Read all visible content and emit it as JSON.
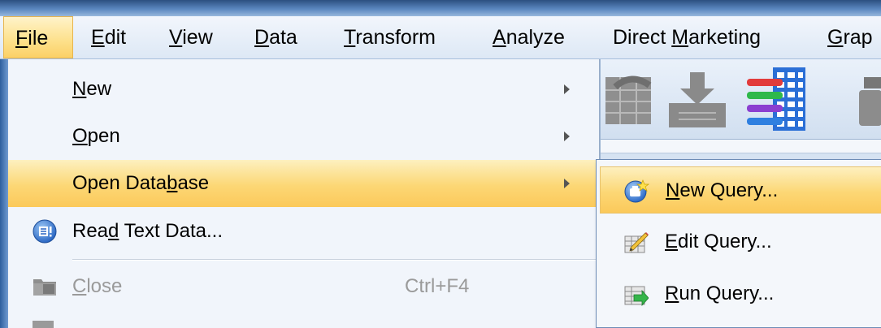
{
  "menubar": {
    "items": [
      {
        "pre": "",
        "mn": "F",
        "post": "ile"
      },
      {
        "pre": "",
        "mn": "E",
        "post": "dit"
      },
      {
        "pre": "",
        "mn": "V",
        "post": "iew"
      },
      {
        "pre": "",
        "mn": "D",
        "post": "ata"
      },
      {
        "pre": "",
        "mn": "T",
        "post": "ransform"
      },
      {
        "pre": "",
        "mn": "A",
        "post": "nalyze"
      },
      {
        "pre": "Direct ",
        "mn": "M",
        "post": "arketing"
      },
      {
        "pre": "",
        "mn": "G",
        "post": "rap"
      }
    ]
  },
  "file_menu": {
    "items": [
      {
        "pre": "",
        "mn": "N",
        "post": "ew",
        "submenu": true
      },
      {
        "pre": "",
        "mn": "O",
        "post": "pen",
        "submenu": true
      },
      {
        "pre": "Open Data",
        "mn": "b",
        "post": "ase",
        "submenu": true
      },
      {
        "pre": "Rea",
        "mn": "d",
        "post": " Text Data...",
        "icon": "read-text-data-icon"
      },
      {
        "pre": "",
        "mn": "C",
        "post": "lose",
        "shortcut": "Ctrl+F4",
        "icon": "close-icon",
        "disabled": true
      }
    ]
  },
  "database_submenu": {
    "items": [
      {
        "pre": "",
        "mn": "N",
        "post": "ew Query...",
        "icon": "new-query-icon"
      },
      {
        "pre": "",
        "mn": "E",
        "post": "dit Query...",
        "icon": "edit-query-icon"
      },
      {
        "pre": "",
        "mn": "R",
        "post": "un Query...",
        "icon": "run-query-icon"
      }
    ]
  },
  "colors": {
    "highlight": "#fcd775",
    "menu_bg": "#f1f5fb",
    "window_blue": "#3b6fb6"
  }
}
